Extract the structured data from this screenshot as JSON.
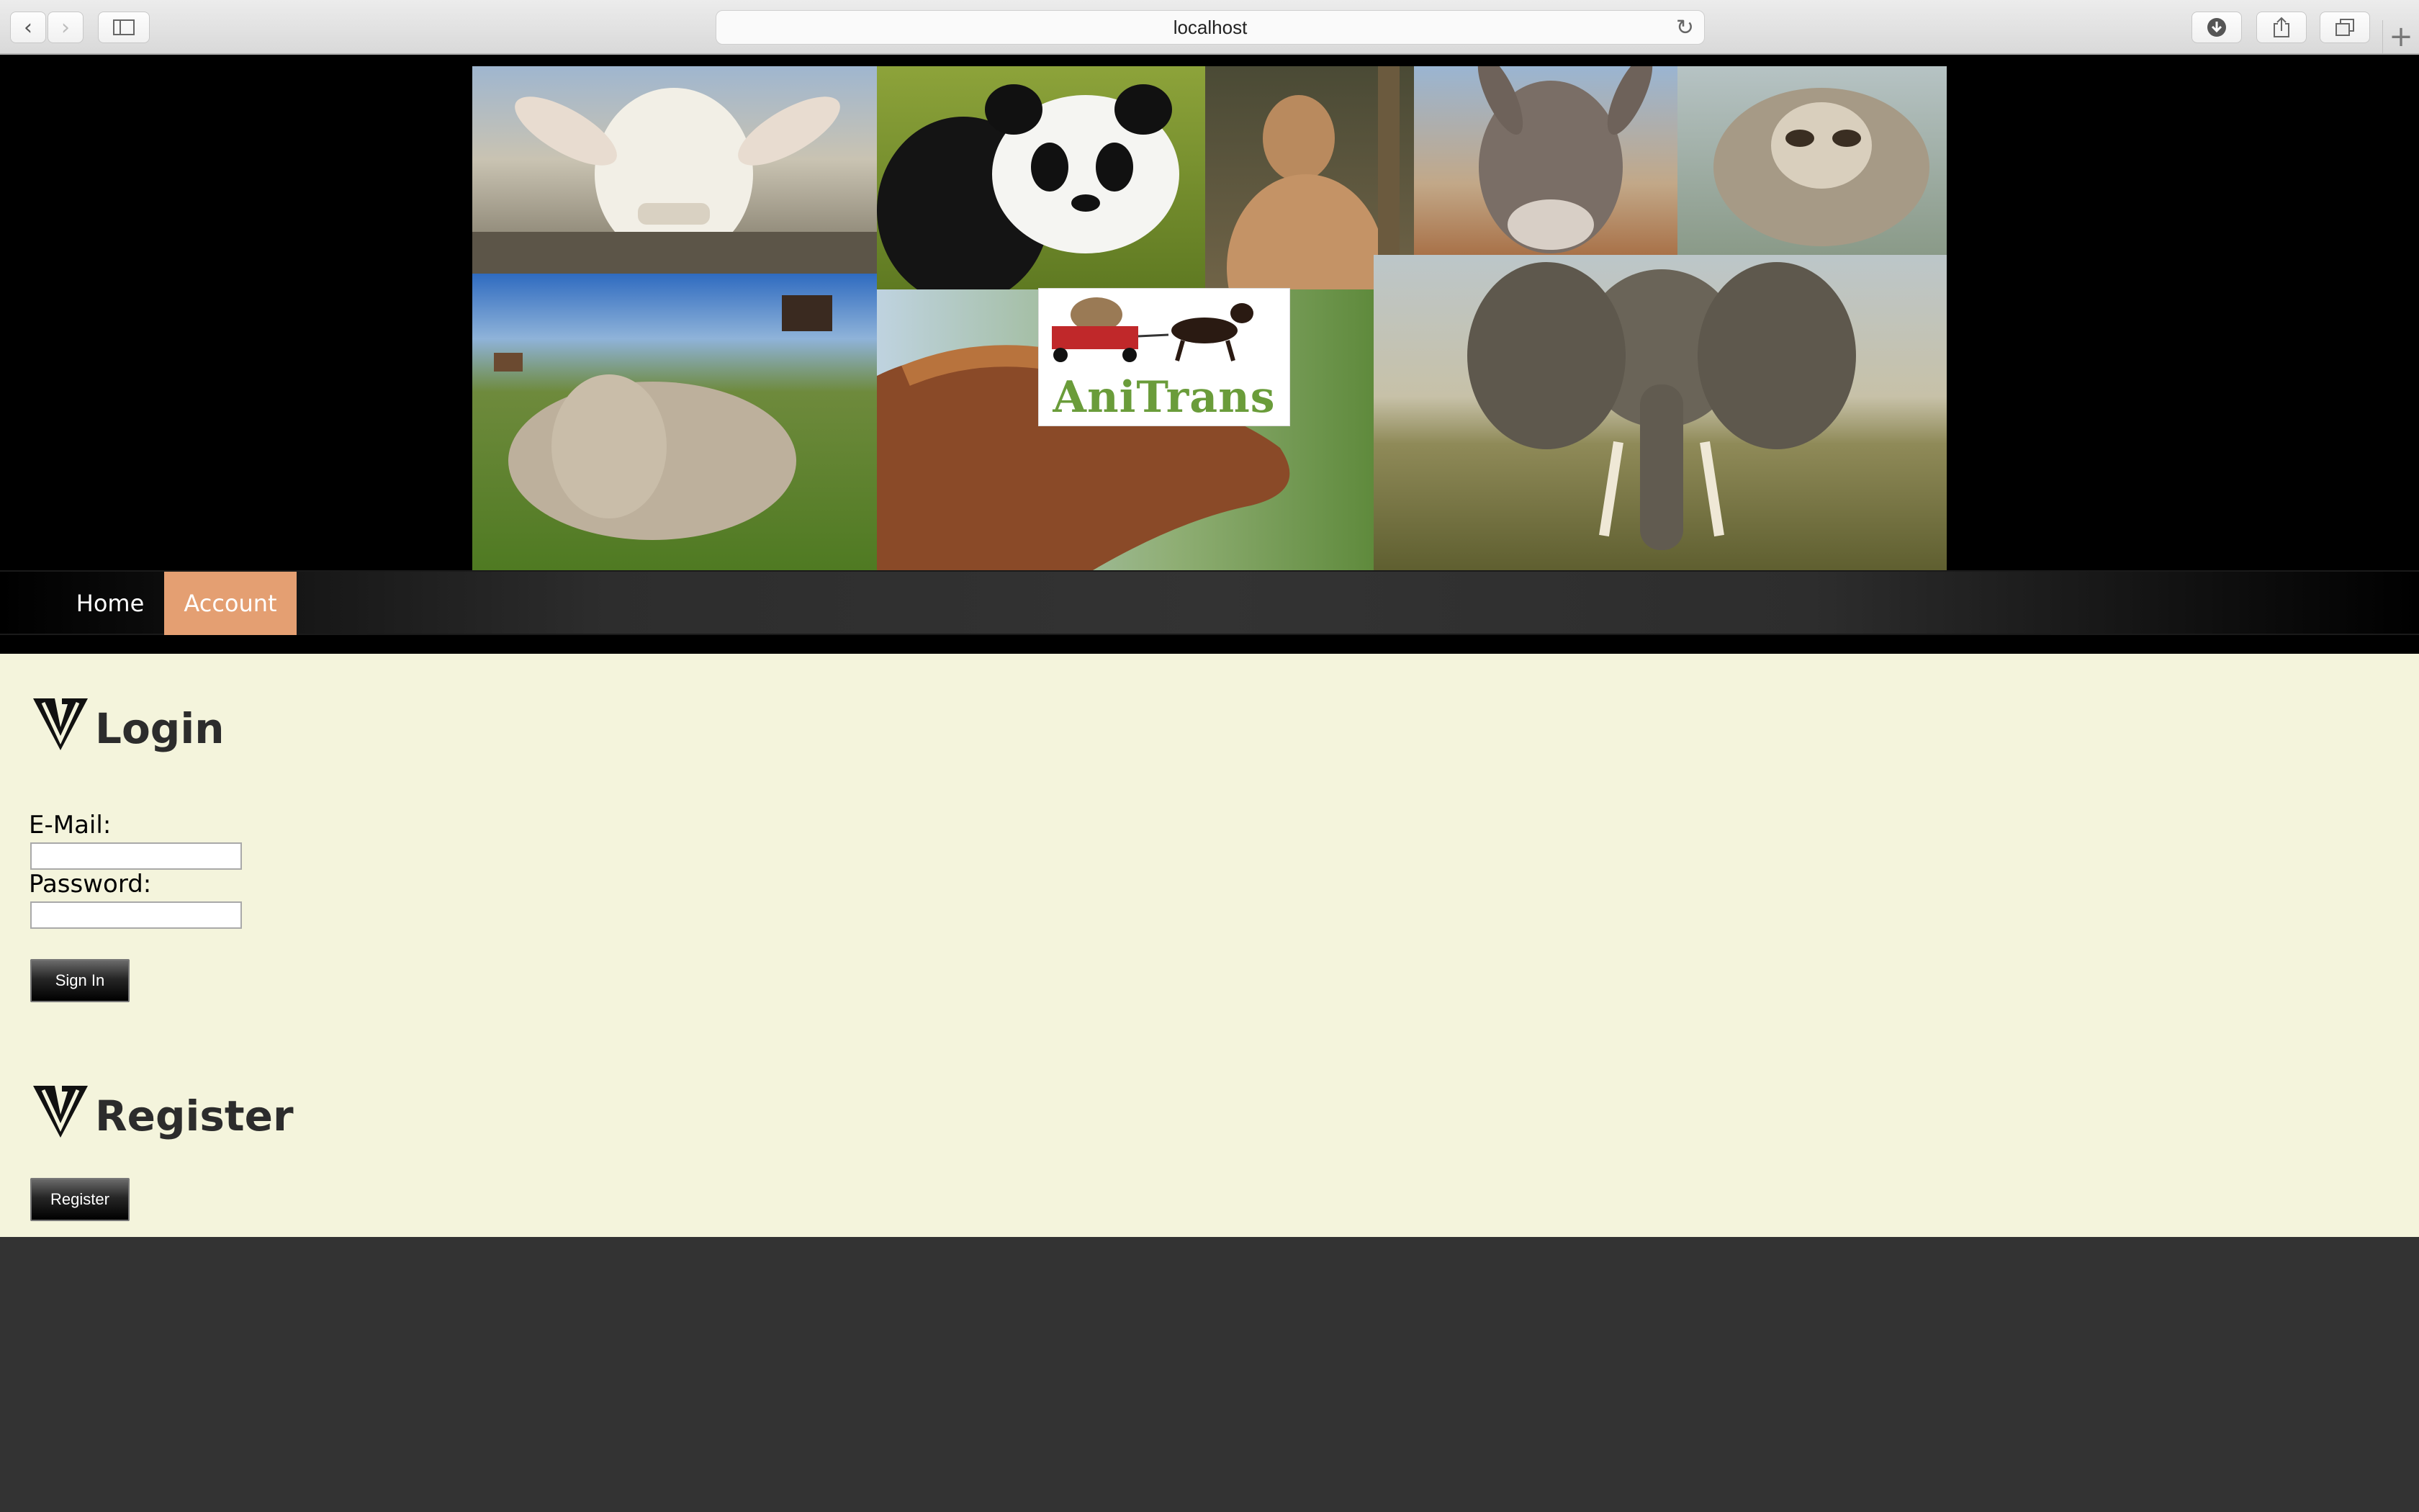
{
  "browser": {
    "url": "localhost",
    "back_icon": "chevron-left-icon",
    "forward_icon": "chevron-right-icon",
    "sidebar_icon": "sidebar-icon",
    "reload_icon": "reload-icon",
    "download_icon": "download-icon",
    "share_icon": "share-icon",
    "tabs_icon": "tabs-icon",
    "new_tab_icon": "plus-icon"
  },
  "banner": {
    "logo_text": "AniTrans",
    "images": [
      "goat",
      "panda",
      "kangaroo",
      "donkey",
      "sloth",
      "cow",
      "horse",
      "elephant",
      "rabbit-in-wagon-pulled-by-dog"
    ]
  },
  "nav": {
    "items": [
      {
        "label": "Home",
        "active": false
      },
      {
        "label": "Account",
        "active": true
      }
    ],
    "active_color": "#e49f72"
  },
  "login": {
    "title": "Login",
    "email_label": "E-Mail:",
    "email_value": "",
    "password_label": "Password:",
    "password_value": "",
    "submit_label": "Sign In"
  },
  "register": {
    "title": "Register",
    "button_label": "Register"
  },
  "colors": {
    "content_bg": "#f4f4dc",
    "page_bg": "#333333",
    "heading": "#2c2c2c"
  }
}
